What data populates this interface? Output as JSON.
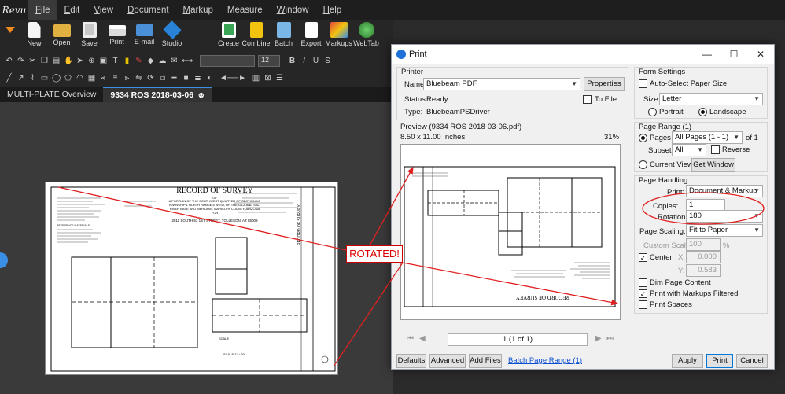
{
  "app": {
    "logo_text": "Revu"
  },
  "menu": [
    "File",
    "Edit",
    "View",
    "Document",
    "Markup",
    "Measure",
    "Window",
    "Help"
  ],
  "toolbar": {
    "buttons": [
      {
        "label": "New",
        "icon": "new-document-icon",
        "color": "#f5f5f5"
      },
      {
        "label": "Open",
        "icon": "open-folder-icon",
        "color": "#e0b040"
      },
      {
        "label": "Save",
        "icon": "save-disk-icon",
        "color": "#c8c8c8"
      },
      {
        "label": "Print",
        "icon": "printer-icon",
        "color": "#dcdcdc"
      },
      {
        "label": "E-mail",
        "icon": "email-icon",
        "color": "#4a90d9"
      },
      {
        "label": "Studio",
        "icon": "studio-icon",
        "color": "#2a82d8"
      },
      {
        "label": "Create",
        "icon": "create-icon",
        "color": "#3aa655"
      },
      {
        "label": "Combine",
        "icon": "combine-icon",
        "color": "#f2c40f"
      },
      {
        "label": "Batch",
        "icon": "batch-icon",
        "color": "#7ab6e6"
      },
      {
        "label": "Export",
        "icon": "export-icon",
        "color": "#ffffff"
      },
      {
        "label": "Markups",
        "icon": "markups-icon",
        "color": "#e54a3c"
      },
      {
        "label": "WebTab",
        "icon": "webtab-globe-icon",
        "color": "#3fa33f"
      }
    ],
    "font_size_value": "12",
    "font_style_buttons": [
      "B",
      "I",
      "U",
      "S"
    ]
  },
  "tabs": [
    {
      "label": "MULTI-PLATE Overview",
      "active": false
    },
    {
      "label": "9334 ROS 2018-03-06",
      "active": true
    }
  ],
  "document": {
    "title": "RECORD OF SURVEY",
    "of": "OF",
    "lines": [
      "A PORTION OF THE SOUTHWEST QUARTER OF SECTION 19,",
      "TOWNSHIP 1 NORTH RANGE 5 WEST, OF THE GILA AND SALT",
      "RIVER BASE AND MERIDIAN, MARICOPA COUNTY, ARIZONA",
      "FOR"
    ],
    "address": "2811 SOUTH 53 1ST STREET, TOLLESON, AZ 85009",
    "notes_heading": "REFERENCE MATERIALS",
    "side_text": "RECORD OF SURVEY",
    "scale": "SCALE 1\" = 60'"
  },
  "annotation": {
    "callout": "ROTATED!",
    "color": "#e02020"
  },
  "dialog": {
    "title": "Print",
    "printer": {
      "group_label": "Printer",
      "name_label": "Name:",
      "name_value": "Bluebeam PDF",
      "properties_button": "Properties",
      "status_label": "Status:",
      "status_value": "Ready",
      "type_label": "Type:",
      "type_value": "BluebeamPSDriver",
      "to_file_label": "To File"
    },
    "preview": {
      "label": "Preview (9334 ROS 2018-03-06.pdf)",
      "size": "8.50  x  11.00 Inches",
      "zoom": "31%",
      "page_counter": "1 (1 of 1)"
    },
    "form_settings": {
      "group_label": "Form Settings",
      "auto_select_label": "Auto-Select Paper Size",
      "size_label": "Size:",
      "size_value": "Letter",
      "portrait_label": "Portrait",
      "landscape_label": "Landscape",
      "orientation": "landscape"
    },
    "page_range": {
      "group_label": "Page Range (1)",
      "pages_label": "Pages",
      "pages_value": "All Pages (1 - 1)",
      "of_text": "of 1",
      "subset_label": "Subset:",
      "subset_value": "All",
      "reverse_label": "Reverse",
      "current_view_label": "Current View",
      "get_window_button": "Get Window"
    },
    "page_handling": {
      "group_label": "Page Handling",
      "print_label": "Print:",
      "print_value": "Document & Markup",
      "copies_label": "Copies:",
      "copies_value": "1",
      "rotation_label": "Rotation:",
      "rotation_value": "180",
      "scaling_label": "Page Scaling:",
      "scaling_value": "Fit to Paper",
      "custom_scale_label": "Custom Scale:",
      "custom_scale_value": "100",
      "custom_scale_unit": "%",
      "center_label": "Center",
      "x_label": "X:",
      "x_value": "0.000",
      "y_label": "Y:",
      "y_value": "0.583",
      "dim_page_content_label": "Dim Page Content",
      "print_markups_filtered_label": "Print with Markups Filtered",
      "print_spaces_label": "Print Spaces"
    },
    "footer": {
      "defaults": "Defaults",
      "advanced": "Advanced",
      "add_files": "Add Files",
      "batch_page_range": "Batch Page Range (1)",
      "apply": "Apply",
      "print": "Print",
      "cancel": "Cancel"
    }
  }
}
